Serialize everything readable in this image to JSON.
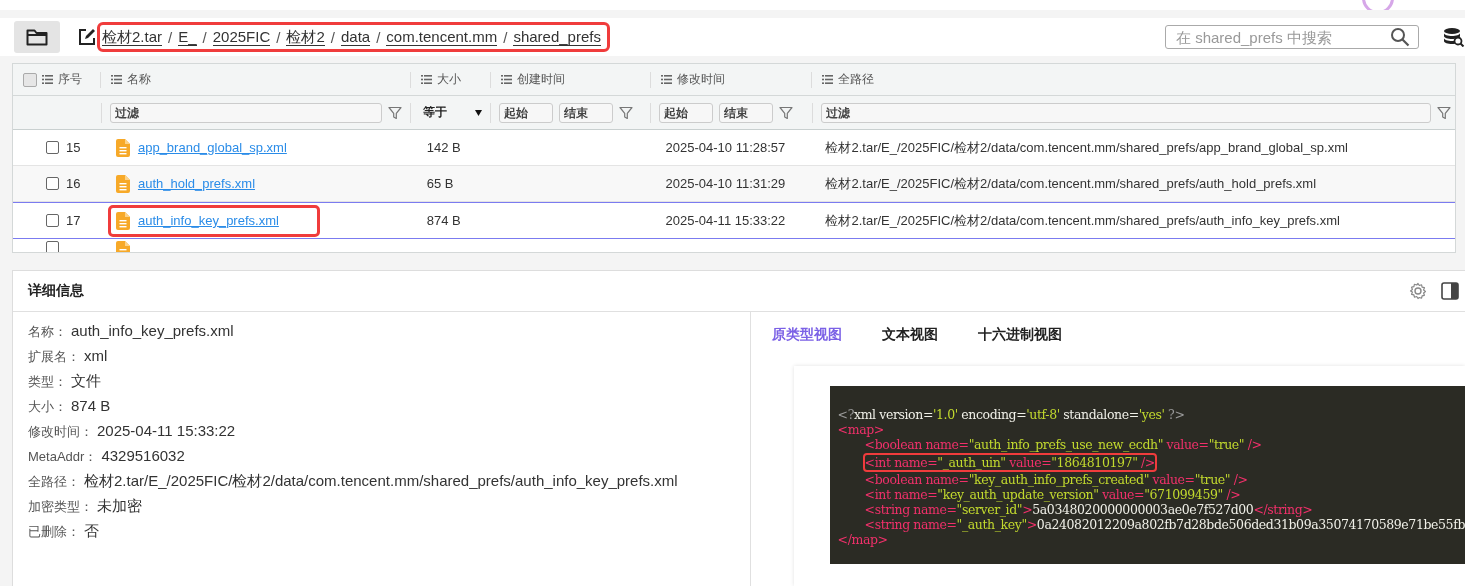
{
  "toolbar": {
    "breadcrumb": [
      "检材2.tar",
      "E_",
      "2025FIC",
      "检材2",
      "data",
      "com.tencent.mm",
      "shared_prefs"
    ],
    "breadcrumb_highlighted": true,
    "separator": "/",
    "search": {
      "placeholder": "在 shared_prefs 中搜索"
    }
  },
  "table": {
    "select_all": {
      "checked": false
    },
    "columns": [
      "序号",
      "名称",
      "大小",
      "创建时间",
      "修改时间",
      "全路径"
    ],
    "filters": {
      "name": {
        "placeholder": "过滤"
      },
      "size_op": "等于",
      "created_from": {
        "placeholder": "起始"
      },
      "created_to": {
        "placeholder": "结束"
      },
      "modified_from": {
        "placeholder": "起始"
      },
      "modified_to": {
        "placeholder": "结束"
      },
      "path": {
        "placeholder": "过滤"
      }
    },
    "rows": [
      {
        "index": "15",
        "name": "app_brand_global_sp.xml",
        "size": "142 B",
        "modified": "2025-04-10 11:28:57",
        "path": "检材2.tar/E_/2025FIC/检材2/data/com.tencent.mm/shared_prefs/app_brand_global_sp.xml",
        "checked": false,
        "selected": false,
        "highlighted": false
      },
      {
        "index": "16",
        "name": "auth_hold_prefs.xml",
        "size": "65 B",
        "modified": "2025-04-10 11:31:29",
        "path": "检材2.tar/E_/2025FIC/检材2/data/com.tencent.mm/shared_prefs/auth_hold_prefs.xml",
        "checked": false,
        "selected": false,
        "highlighted": false
      },
      {
        "index": "17",
        "name": "auth_info_key_prefs.xml",
        "size": "874 B",
        "modified": "2025-04-11 15:33:22",
        "path": "检材2.tar/E_/2025FIC/检材2/data/com.tencent.mm/shared_prefs/auth_info_key_prefs.xml",
        "checked": false,
        "selected": true,
        "highlighted": true
      }
    ],
    "clipped_row": {
      "checked": false
    }
  },
  "details": {
    "title": "详细信息",
    "properties": [
      {
        "label": "名称：",
        "value": "auth_info_key_prefs.xml"
      },
      {
        "label": "扩展名：",
        "value": "xml"
      },
      {
        "label": "类型：",
        "value": "文件"
      },
      {
        "label": "大小：",
        "value": "874 B"
      },
      {
        "label": "修改时间：",
        "value": "2025-04-11 15:33:22"
      },
      {
        "label": "MetaAddr：",
        "value": "4329516032"
      },
      {
        "label": "全路径：",
        "value": "检材2.tar/E_/2025FIC/检材2/data/com.tencent.mm/shared_prefs/auth_info_key_prefs.xml"
      },
      {
        "label": "加密类型：",
        "value": "未加密"
      },
      {
        "label": "已删除：",
        "value": "否"
      }
    ],
    "tabs": [
      {
        "label": "原类型视图",
        "selected": true
      },
      {
        "label": "文本视图",
        "selected": false
      },
      {
        "label": "十六进制视图",
        "selected": false
      }
    ],
    "xml": [
      {
        "highlighted": false,
        "tokens": [
          {
            "kind": "decl",
            "text": "<?"
          },
          {
            "kind": "text",
            "text": "xml version="
          },
          {
            "kind": "value",
            "text": "'1.0'"
          },
          {
            "kind": "text",
            "text": " encoding="
          },
          {
            "kind": "value",
            "text": "'utf-8'"
          },
          {
            "kind": "text",
            "text": " standalone="
          },
          {
            "kind": "value",
            "text": "'yes'"
          },
          {
            "kind": "decl",
            "text": " ?>"
          }
        ]
      },
      {
        "highlighted": false,
        "tokens": [
          {
            "kind": "tag",
            "text": "<map>"
          }
        ],
        "children": [
          {
            "highlighted": false,
            "tokens": [
              {
                "kind": "tag",
                "text": "<boolean name="
              },
              {
                "kind": "value",
                "text": "\"auth_info_prefs_use_new_ecdh\""
              },
              {
                "kind": "tag",
                "text": " value="
              },
              {
                "kind": "value",
                "text": "\"true\""
              },
              {
                "kind": "tag",
                "text": " />"
              }
            ]
          },
          {
            "highlighted": true,
            "tokens": [
              {
                "kind": "tag",
                "text": "<int name="
              },
              {
                "kind": "value",
                "text": "\"_auth_uin\""
              },
              {
                "kind": "tag",
                "text": " value="
              },
              {
                "kind": "value",
                "text": "\"1864810197\""
              },
              {
                "kind": "tag",
                "text": " />"
              }
            ]
          },
          {
            "highlighted": false,
            "tokens": [
              {
                "kind": "tag",
                "text": "<boolean name="
              },
              {
                "kind": "value",
                "text": "\"key_auth_info_prefs_created\""
              },
              {
                "kind": "tag",
                "text": " value="
              },
              {
                "kind": "value",
                "text": "\"true\""
              },
              {
                "kind": "tag",
                "text": " />"
              }
            ]
          },
          {
            "highlighted": false,
            "tokens": [
              {
                "kind": "tag",
                "text": "<int name="
              },
              {
                "kind": "value",
                "text": "\"key_auth_update_version\""
              },
              {
                "kind": "tag",
                "text": " value="
              },
              {
                "kind": "value",
                "text": "\"671099459\""
              },
              {
                "kind": "tag",
                "text": " />"
              }
            ]
          },
          {
            "highlighted": false,
            "tokens": [
              {
                "kind": "tag",
                "text": "<string name="
              },
              {
                "kind": "value",
                "text": "\"server_id\""
              },
              {
                "kind": "tag",
                "text": ">"
              },
              {
                "kind": "text",
                "text": "5a0348020000000003ae0e7f527d00"
              },
              {
                "kind": "tag",
                "text": "</string>"
              }
            ]
          },
          {
            "highlighted": false,
            "tokens": [
              {
                "kind": "tag",
                "text": "<string name="
              },
              {
                "kind": "value",
                "text": "\"_auth_key\""
              },
              {
                "kind": "tag",
                "text": ">"
              },
              {
                "kind": "text",
                "text": "0a24082012209a802fb7d28bde506ded31b09a35074170589e71be55fb"
              }
            ]
          }
        ]
      },
      {
        "highlighted": false,
        "tokens": [
          {
            "kind": "tag",
            "text": "</map>"
          }
        ]
      }
    ]
  }
}
